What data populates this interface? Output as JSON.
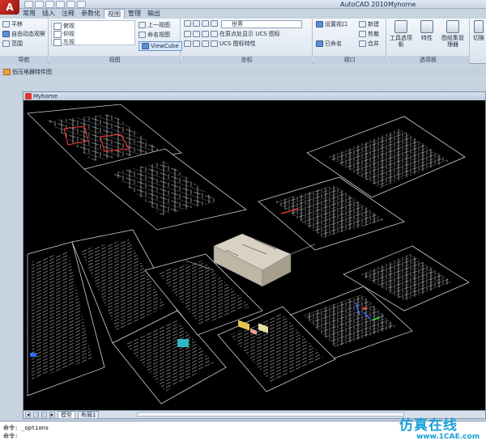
{
  "titlebar": {
    "app_title": "AutoCAD 2010",
    "doc_title": "Myhome",
    "logo_letter": "A"
  },
  "tabs": [
    "常用",
    "插入",
    "注释",
    "参数化",
    "视图",
    "管理",
    "输出"
  ],
  "active_tab": "视图",
  "ribbon": {
    "navigate": {
      "title": "导航",
      "items": [
        "平移",
        "自由动态观察",
        "范围"
      ]
    },
    "views": {
      "title": "视图",
      "left_items": [
        "俯视",
        "仰视",
        "左视"
      ],
      "right_items": [
        "上一视图",
        "命名视图",
        "ViewCube"
      ]
    },
    "coordinates": {
      "title": "坐标",
      "ucs_combo": "世界",
      "items": [
        "在原点处显示 UCS 图标",
        "UCS 图标特性"
      ]
    },
    "viewports": {
      "title": "视口",
      "items": [
        "设置视口",
        "新建",
        "剪裁",
        "已命名",
        "合并"
      ]
    },
    "palettes": {
      "title": "选项板",
      "buttons": [
        "工具选项板",
        "特性",
        "图纸集管理器"
      ]
    },
    "right_cut": "切换"
  },
  "document_tab": "低压电器特件图",
  "drawing_window": {
    "title": "Myhome",
    "layout_tabs": [
      "模型",
      "布局1"
    ],
    "active_layout": "模型"
  },
  "command_line": {
    "lines": [
      "命令: _options",
      "命令:"
    ]
  },
  "watermark": {
    "text": "仿真在线",
    "url": "www.1CAE.com"
  },
  "colors": {
    "canvas_bg": "#000000",
    "accent_blue": "#1aa0d8",
    "logo_red": "#d9322b"
  }
}
